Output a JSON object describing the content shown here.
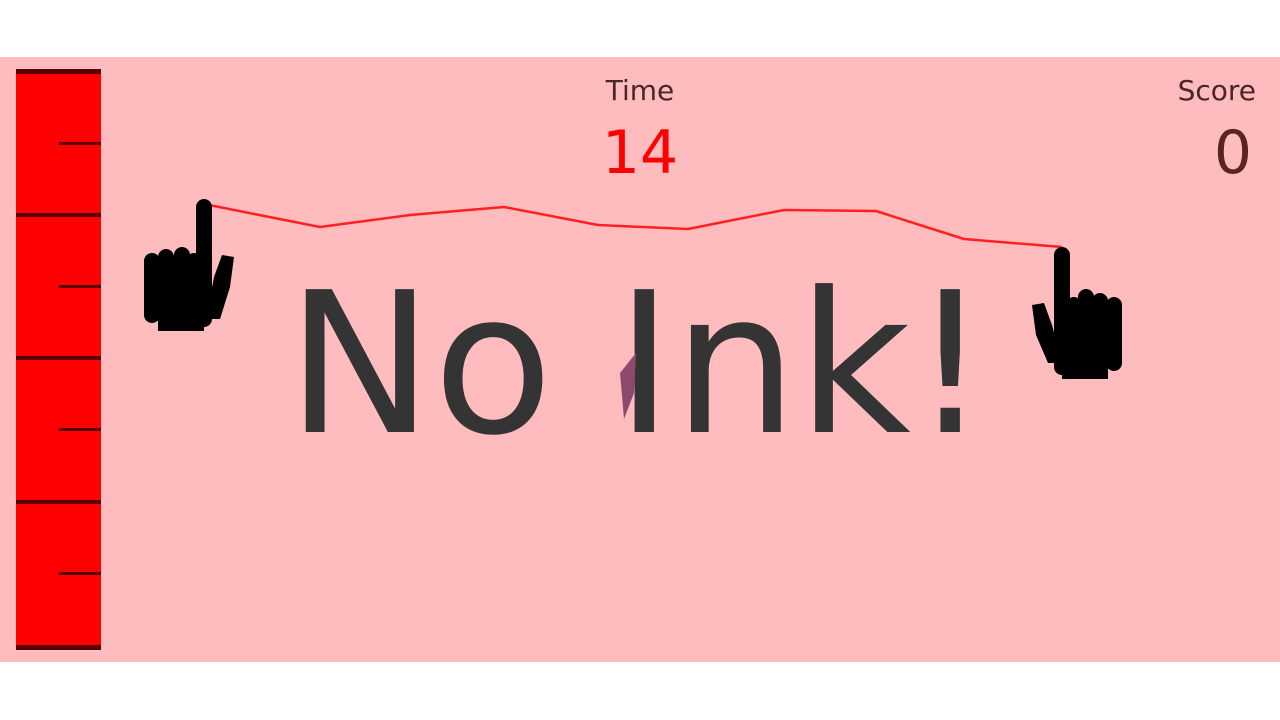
{
  "hud": {
    "time_label": "Time",
    "time_value": "14",
    "score_label": "Score",
    "score_value": "0"
  },
  "message": {
    "text": "No Ink!"
  },
  "ink_gauge": {
    "level": 1.0,
    "fill_color": "#ff0000",
    "tick_color": "#5a0000"
  },
  "colors": {
    "background": "#ffbcbe",
    "ink_line": "#ff2020",
    "text_dark": "#343434",
    "time_value": "#ff0000",
    "score_value": "#5a2424"
  },
  "icons": {
    "left_hand": "pointing-hand-icon",
    "right_hand": "pointing-hand-icon",
    "shard": "ink-shard-icon"
  }
}
